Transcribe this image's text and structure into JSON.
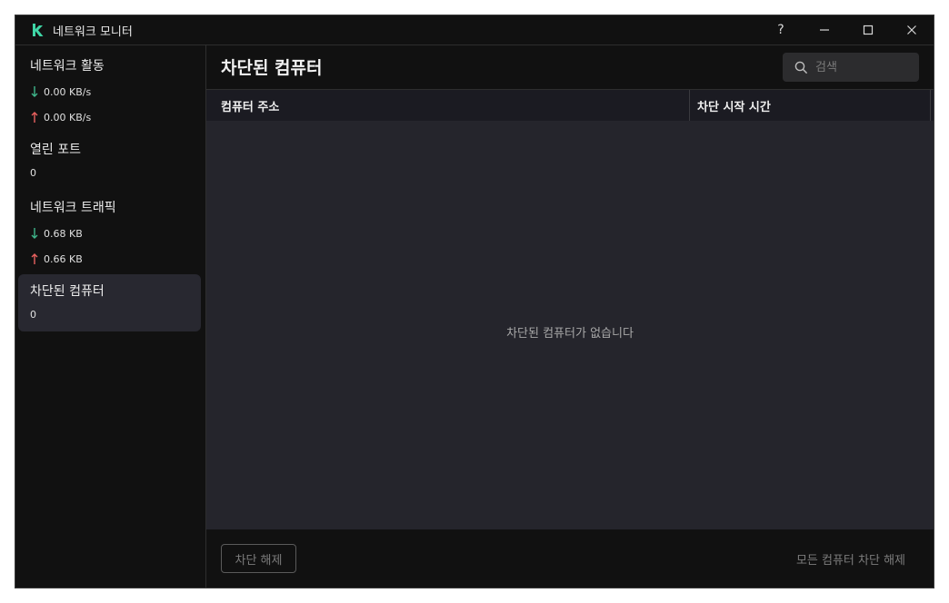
{
  "window": {
    "title": "네트워크 모니터"
  },
  "titlebar": {
    "help": "?"
  },
  "sidebar": {
    "network_activity": {
      "title": "네트워크 활동",
      "down": "0.00 KB/s",
      "up": "0.00 KB/s"
    },
    "open_ports": {
      "title": "열린 포트",
      "value": "0"
    },
    "network_traffic": {
      "title": "네트워크 트래픽",
      "down": "0.68 KB",
      "up": "0.66 KB"
    },
    "blocked_computers": {
      "title": "차단된 컴퓨터",
      "value": "0"
    }
  },
  "main": {
    "title": "차단된 컴퓨터",
    "search_placeholder": "검색",
    "columns": [
      "컴퓨터 주소",
      "차단 시작 시간"
    ],
    "empty_message": "차단된 컴퓨터가 없습니다",
    "unblock_button": "차단 해제",
    "unblock_all_button": "모든 컴퓨터 차단 해제"
  },
  "colors": {
    "down_arrow": "#3fb68b",
    "up_arrow": "#e8615f",
    "logo": "#3fd6a6"
  },
  "icons": [
    "kaspersky-logo-icon",
    "help-icon",
    "minimize-icon",
    "maximize-icon",
    "close-icon",
    "arrow-down-icon",
    "arrow-up-icon",
    "search-icon"
  ]
}
